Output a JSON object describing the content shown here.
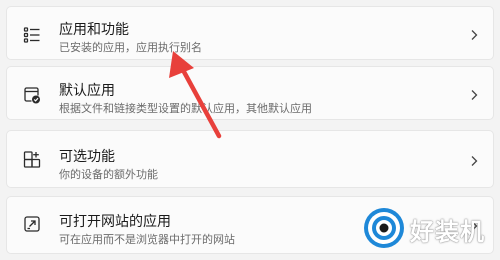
{
  "items": [
    {
      "title": "应用和功能",
      "description": "已安装的应用，应用执行别名",
      "icon": "apps-list-icon"
    },
    {
      "title": "默认应用",
      "description": "根据文件和链接类型设置的默认应用，其他默认应用",
      "icon": "default-apps-icon"
    },
    {
      "title": "可选功能",
      "description": "你的设备的额外功能",
      "icon": "optional-features-icon"
    },
    {
      "title": "可打开网站的应用",
      "description": "可在应用而不是浏览器中打开的网站",
      "icon": "open-website-icon"
    }
  ],
  "annotation": {
    "arrow_color": "#e8403b"
  },
  "watermark": {
    "text": "好装机",
    "brand_color": "#1e88d8"
  }
}
